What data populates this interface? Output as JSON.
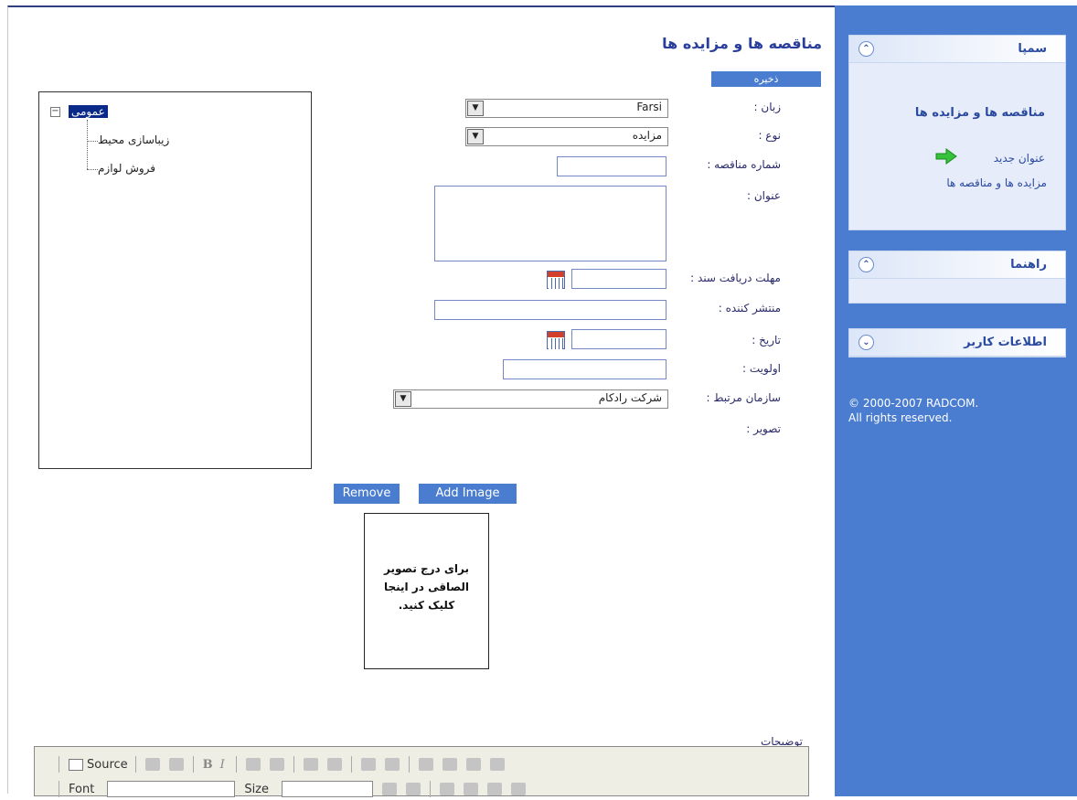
{
  "sidebar": {
    "panels": [
      {
        "title": "سمپا",
        "toggle_icon": "chevron-up-double-icon",
        "body_title": "مناقصه ها و مزایده ها",
        "new_link": "عنوان جدید",
        "list_link": "مزایده ها و مناقصه ها"
      },
      {
        "title": "راهنما",
        "toggle_icon": "chevron-up-double-icon"
      },
      {
        "title": "اطلاعات کاربر",
        "toggle_icon": "chevron-down-double-icon"
      }
    ],
    "copyright_line1": "© 2000-2007 RADCOM.",
    "copyright_line2": "All rights reserved."
  },
  "main": {
    "title": "مناقصه ها و مزایده ها",
    "save_label": "ذخیره",
    "tree": {
      "root": "عمومی",
      "children": [
        "زیباسازی محیط",
        "فروش لوازم"
      ]
    },
    "form": {
      "language_label": "زبان :",
      "language_value": "Farsi",
      "type_label": "نوع :",
      "type_value": "مزایده",
      "tender_number_label": "شماره مناقصه :",
      "title_label": "عنوان :",
      "deadline_label": "مهلت دریافت سند :",
      "publisher_label": "منتشر کننده :",
      "date_label": "تاریخ :",
      "priority_label": "اولویت :",
      "organization_label": "سازمان مرتبط :",
      "organization_value": "شرکت رادکام",
      "image_label": "تصویر :"
    },
    "image": {
      "remove_label": "Remove",
      "add_label": "Add Image",
      "placeholder": "برای درج تصویر الصاقی در اینجا کلیک کنید."
    },
    "description_label": "توضیحات",
    "editor": {
      "source_label": "Source",
      "bold_label": "B",
      "italic_label": "I",
      "font_label": "Font",
      "size_label": "Size"
    }
  },
  "colors": {
    "sidebar_bg": "#4a7dd0",
    "accent": "#2a3f9c"
  }
}
